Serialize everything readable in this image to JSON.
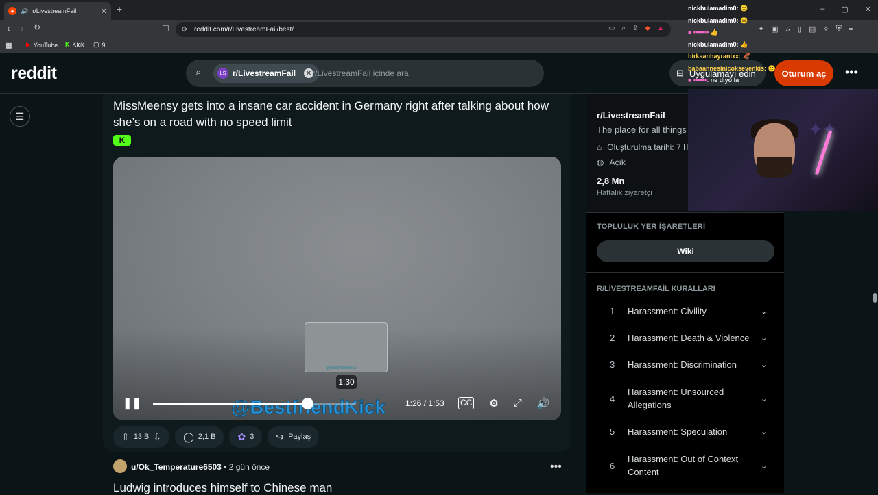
{
  "browser": {
    "tab_title": "r/LivestreamFail",
    "url": "reddit.com/r/LivestreamFail/best/",
    "bookmarks": [
      {
        "label": "YouTube"
      },
      {
        "label": "Kick"
      },
      {
        "label": "9"
      }
    ],
    "controls": {
      "minimize": "–",
      "maximize": "▢",
      "close": "✕"
    }
  },
  "header": {
    "logo": "reddit",
    "search_chip": "r/LivestreamFail",
    "search_placeholder": "r/LivestreamFail içinde ara",
    "get_app": "Uygulamayı edin",
    "login": "Oturum aç"
  },
  "post": {
    "title": "MissMeensy gets into a insane car accident in Germany right after talking about how she’s on a road with no speed limit",
    "kick_badge": "K",
    "video": {
      "hover_time": "1:30",
      "time": "1:26 / 1:53",
      "progress": 0.76,
      "watermark": "@BestfriendKick",
      "thumb_watermark": "@BestfriendKick"
    },
    "actions": {
      "votes": "13 B",
      "comments": "2,1 B",
      "awards": "3",
      "share": "Paylaş"
    }
  },
  "next_post": {
    "user": "u/Ok_Temperature6503",
    "time": "• 2 gün önce",
    "title": "Ludwig introduces himself to Chinese man"
  },
  "sidebar": {
    "name": "r/LivestreamFail",
    "description": "The place for all things",
    "created": "Oluşturulma tarihi: 7 H",
    "visibility": "Açık",
    "weekly_count": "2,8 Mn",
    "weekly_label": "Haftalık ziyaretçi",
    "bookmarks_heading": "TOPLULUK YER İŞARETLERİ",
    "wiki": "Wiki",
    "rules_heading": "R/LİVESTREAMFAİL KURALLARI",
    "rules": [
      {
        "n": "1",
        "text": "Harassment: Civility"
      },
      {
        "n": "2",
        "text": "Harassment: Death & Violence"
      },
      {
        "n": "3",
        "text": "Harassment: Discrimination"
      },
      {
        "n": "4",
        "text": "Harassment: Unsourced Allegations"
      },
      {
        "n": "5",
        "text": "Harassment: Speculation"
      },
      {
        "n": "6",
        "text": "Harassment: Out of Context Content"
      }
    ]
  },
  "stream_chat": [
    {
      "user": "nickbulamadim0:",
      "msg": "🙂"
    },
    {
      "user": "nickbulamadim0:",
      "msg": "😐"
    },
    {
      "user": "",
      "msg": "👍"
    },
    {
      "user": "nickbulamadim0:",
      "msg": "👍"
    },
    {
      "user": "birkaanhayranixx:",
      "msg": "🦧"
    },
    {
      "user": "babaannesinicoksevenkis:",
      "msg": "🙂"
    },
    {
      "user": "",
      "msg": "ne diyo la"
    }
  ]
}
